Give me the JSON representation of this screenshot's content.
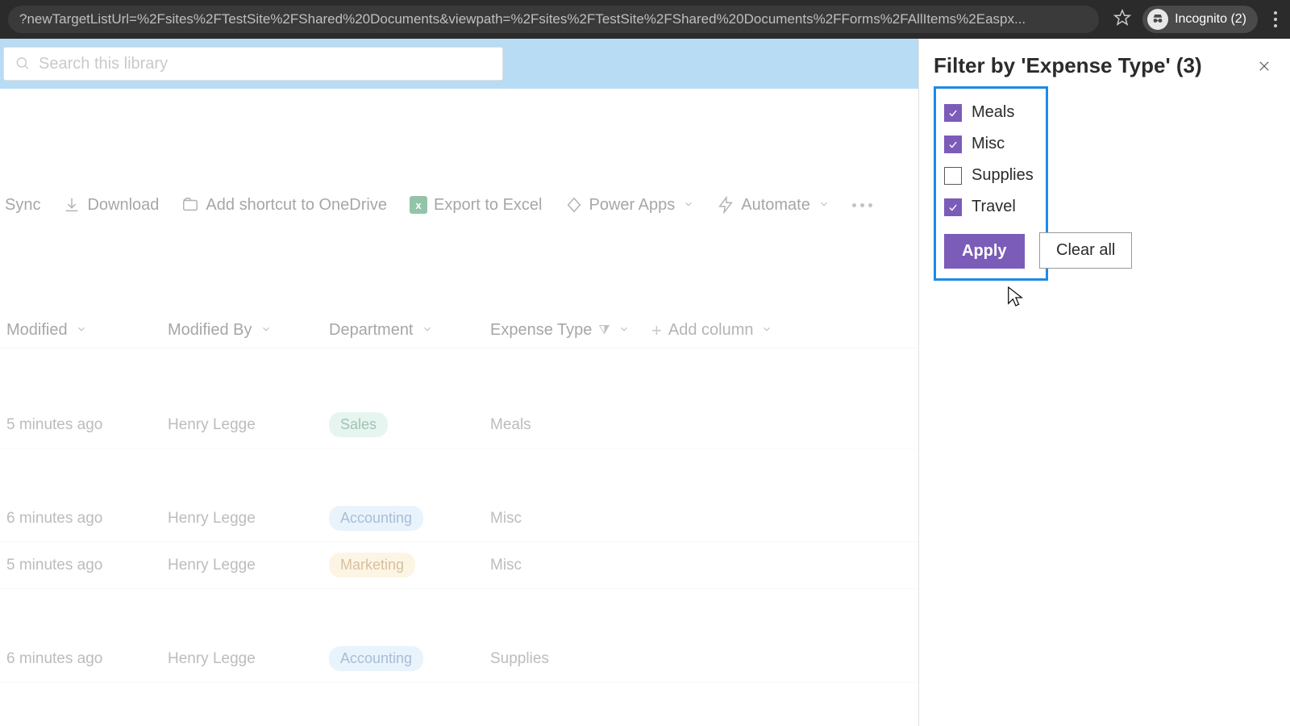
{
  "chrome": {
    "url": "?newTargetListUrl=%2Fsites%2FTestSite%2FShared%20Documents&viewpath=%2Fsites%2FTestSite%2FShared%20Documents%2FForms%2FAllItems%2Easpx...",
    "incognito_label": "Incognito (2)"
  },
  "search": {
    "placeholder": "Search this library"
  },
  "toolbar": {
    "sync": "Sync",
    "download": "Download",
    "shortcut": "Add shortcut to OneDrive",
    "export": "Export to Excel",
    "powerapps": "Power Apps",
    "automate": "Automate"
  },
  "columns": {
    "modified": "Modified",
    "modified_by": "Modified By",
    "department": "Department",
    "expense_type": "Expense Type",
    "add": "Add column"
  },
  "rows": [
    {
      "modified": "5 minutes ago",
      "by": "Henry Legge",
      "dept": "Sales",
      "dept_bg": "#c8e9db",
      "dept_fg": "#2e7a57",
      "exp": "Meals",
      "gap": false
    },
    {
      "modified": "6 minutes ago",
      "by": "Henry Legge",
      "dept": "Accounting",
      "dept_bg": "#cfe4f7",
      "dept_fg": "#3d6fa3",
      "exp": "Misc",
      "gap": true
    },
    {
      "modified": "5 minutes ago",
      "by": "Henry Legge",
      "dept": "Marketing",
      "dept_bg": "#fbe9c2",
      "dept_fg": "#a2762d",
      "exp": "Misc",
      "gap": false
    },
    {
      "modified": "6 minutes ago",
      "by": "Henry Legge",
      "dept": "Accounting",
      "dept_bg": "#cfe4f7",
      "dept_fg": "#3d6fa3",
      "exp": "Supplies",
      "gap": true
    }
  ],
  "panel": {
    "title": "Filter by 'Expense Type' (3)",
    "options": [
      {
        "label": "Meals",
        "checked": true
      },
      {
        "label": "Misc",
        "checked": true
      },
      {
        "label": "Supplies",
        "checked": false
      },
      {
        "label": "Travel",
        "checked": true
      }
    ],
    "apply": "Apply",
    "clear": "Clear all"
  }
}
